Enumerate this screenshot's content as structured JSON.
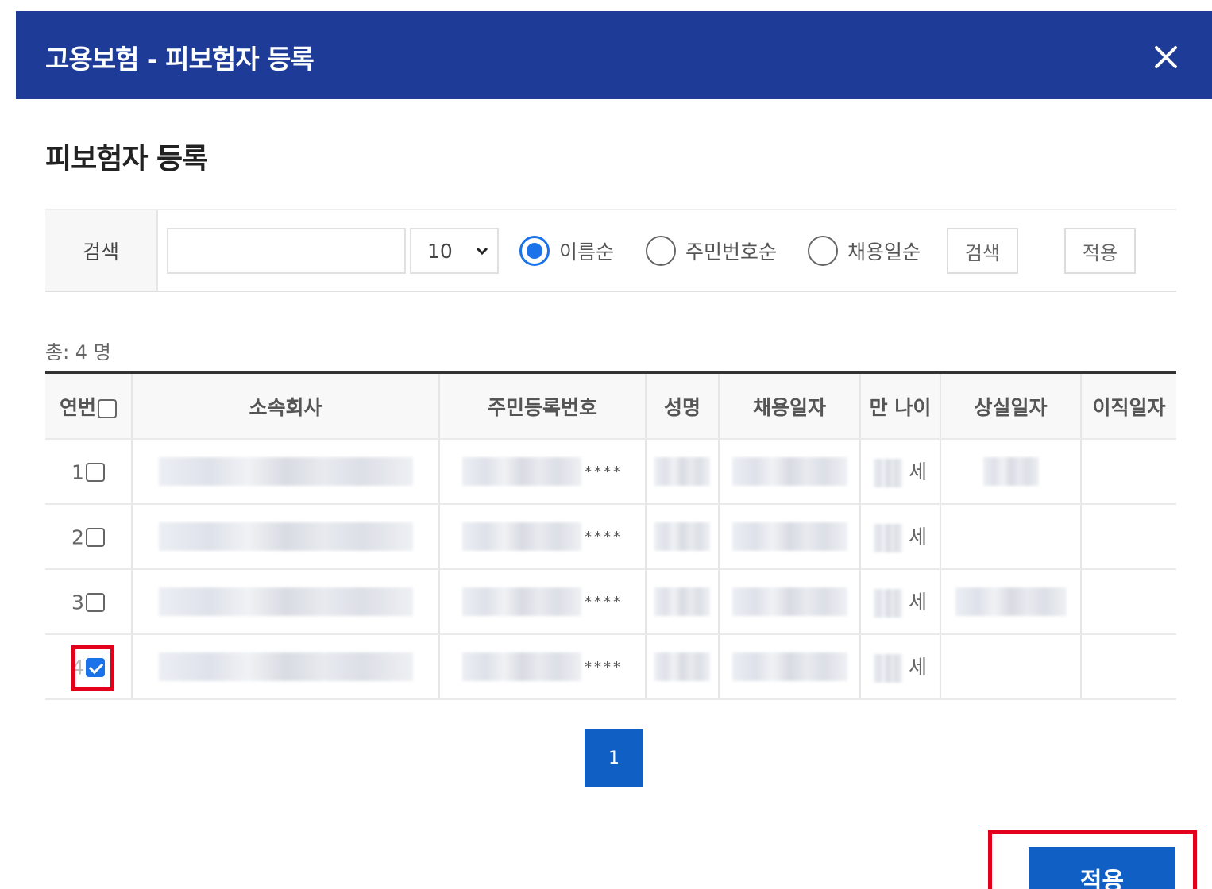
{
  "header": {
    "title": "고용보험 - 피보험자 등록"
  },
  "section": {
    "title": "피보험자 등록"
  },
  "search": {
    "label": "검색",
    "input_value": "",
    "page_size": "10",
    "sort_options": [
      {
        "label": "이름순",
        "checked": true
      },
      {
        "label": "주민번호순",
        "checked": false
      },
      {
        "label": "채용일순",
        "checked": false
      }
    ],
    "search_button": "검색",
    "apply_button": "적용"
  },
  "total": {
    "text": "총: 4 명"
  },
  "table": {
    "headers": [
      "연번",
      "소속회사",
      "주민등록번호",
      "성명",
      "채용일자",
      "만 나이",
      "상실일자",
      "이직일자"
    ],
    "rows": [
      {
        "no": "1",
        "checked": false,
        "rrn_mask": "****",
        "age_unit": "세"
      },
      {
        "no": "2",
        "checked": false,
        "rrn_mask": "****",
        "age_unit": "세"
      },
      {
        "no": "3",
        "checked": false,
        "rrn_mask": "****",
        "age_unit": "세"
      },
      {
        "no": "4",
        "checked": true,
        "rrn_mask": "****",
        "age_unit": "세"
      }
    ]
  },
  "pagination": {
    "current": "1"
  },
  "footer": {
    "apply_label": "적용"
  },
  "colors": {
    "header_bg": "#1e3c97",
    "primary": "#0f5fc4",
    "highlight": "#e3001b"
  }
}
